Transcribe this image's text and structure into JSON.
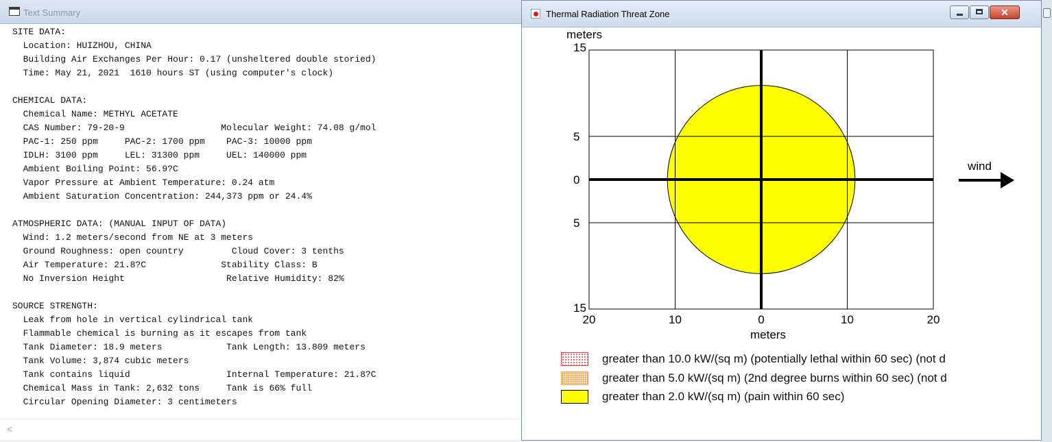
{
  "text_summary_window": {
    "title": "Text Summary",
    "lines": [
      "SITE DATA:",
      "  Location: HUIZHOU, CHINA",
      "  Building Air Exchanges Per Hour: 0.17 (unsheltered double storied)",
      "  Time: May 21, 2021  1610 hours ST (using computer's clock)",
      "",
      "CHEMICAL DATA:",
      "  Chemical Name: METHYL ACETATE",
      "  CAS Number: 79-20-9                  Molecular Weight: 74.08 g/mol",
      "  PAC-1: 250 ppm     PAC-2: 1700 ppm    PAC-3: 10000 ppm",
      "  IDLH: 3100 ppm     LEL: 31300 ppm     UEL: 140000 ppm",
      "  Ambient Boiling Point: 56.9?C",
      "  Vapor Pressure at Ambient Temperature: 0.24 atm",
      "  Ambient Saturation Concentration: 244,373 ppm or 24.4%",
      "",
      "ATMOSPHERIC DATA: (MANUAL INPUT OF DATA)",
      "  Wind: 1.2 meters/second from NE at 3 meters",
      "  Ground Roughness: open country         Cloud Cover: 3 tenths",
      "  Air Temperature: 21.8?C              Stability Class: B",
      "  No Inversion Height                   Relative Humidity: 82%",
      "",
      "SOURCE STRENGTH:",
      "  Leak from hole in vertical cylindrical tank",
      "  Flammable chemical is burning as it escapes from tank",
      "  Tank Diameter: 18.9 meters            Tank Length: 13.809 meters",
      "  Tank Volume: 3,874 cubic meters",
      "  Tank contains liquid                  Internal Temperature: 21.8?C",
      "  Chemical Mass in Tank: 2,632 tons     Tank is 66% full",
      "  Circular Opening Diameter: 3 centimeters"
    ],
    "scroll_arrow": "<"
  },
  "threat_zone_window": {
    "title": "Thermal Radiation Threat Zone",
    "buttons": {
      "minimize": "",
      "maximize": "",
      "close": "✕"
    },
    "wind_label": "wind",
    "legend": [
      {
        "text": "greater than 10.0 kW/(sq m) (potentially lethal within 60 sec) (not d",
        "color": "#e0404a"
      },
      {
        "text": "greater than 5.0 kW/(sq m) (2nd degree burns within 60 sec) (not d",
        "color": "#e0a050"
      },
      {
        "text": "greater than 2.0 kW/(sq m) (pain within 60 sec)",
        "color": "#ffff00"
      }
    ]
  },
  "chart_data": {
    "type": "scatter",
    "title": "",
    "xlabel": "meters",
    "ylabel": "meters",
    "x_ticks": [
      "20",
      "10",
      "0",
      "10",
      "20"
    ],
    "y_ticks": [
      "15",
      "5",
      "0",
      "5",
      "15"
    ],
    "xlim": [
      -20,
      20
    ],
    "ylim": [
      -15,
      15
    ],
    "grid": true,
    "series": [
      {
        "name": "greater than 2.0 kW/(sq m) (pain within 60 sec)",
        "shape": "circle",
        "center": [
          0,
          0
        ],
        "radius_m": 10.9,
        "color": "#ffff00"
      }
    ]
  }
}
